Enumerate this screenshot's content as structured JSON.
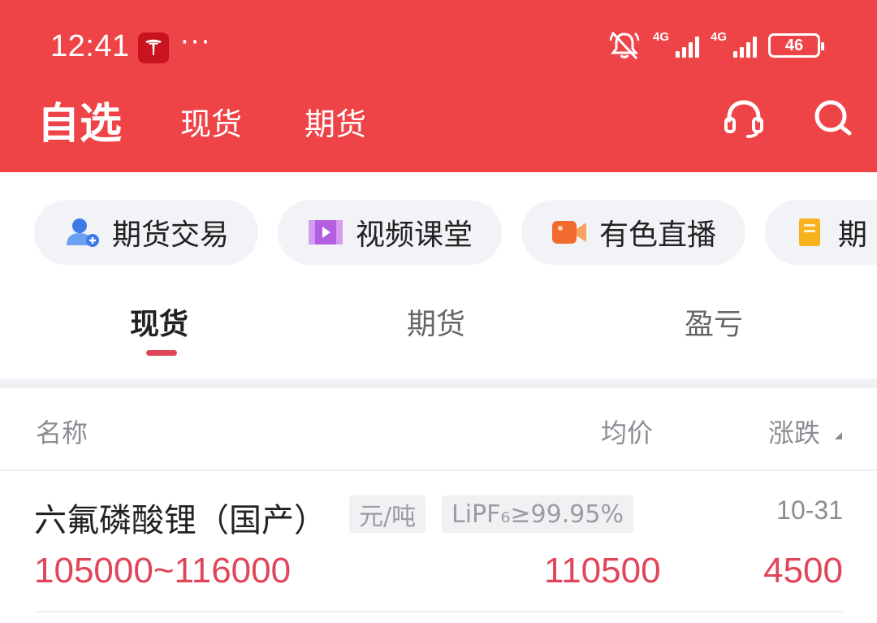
{
  "status_bar": {
    "time": "12:41",
    "dots": "···",
    "signal1_label": "4G",
    "signal2_label": "4G",
    "battery": "46"
  },
  "header": {
    "title": "自选",
    "tabs": [
      "现货",
      "期货"
    ],
    "icons": [
      "headset-icon",
      "search-icon"
    ],
    "bg_color": "#ef4447"
  },
  "chips": [
    {
      "label": "期货交易",
      "icon": "user-trade-icon"
    },
    {
      "label": "视频课堂",
      "icon": "video-class-icon"
    },
    {
      "label": "有色直播",
      "icon": "live-camera-icon"
    },
    {
      "label": "期",
      "icon": "document-icon"
    }
  ],
  "segments": {
    "items": [
      "现货",
      "期货",
      "盈亏"
    ],
    "active": "现货",
    "accent": "#e0455a"
  },
  "columns": {
    "name": "名称",
    "avg": "均价",
    "change": "涨跌"
  },
  "rows": [
    {
      "name": "六氟磷酸锂（国产）",
      "unit_tag": "元/吨",
      "spec_tag": "LiPF₆≥99.95%",
      "date": "10-31",
      "range": "105000~116000",
      "avg": "110500",
      "change": "4500"
    }
  ]
}
